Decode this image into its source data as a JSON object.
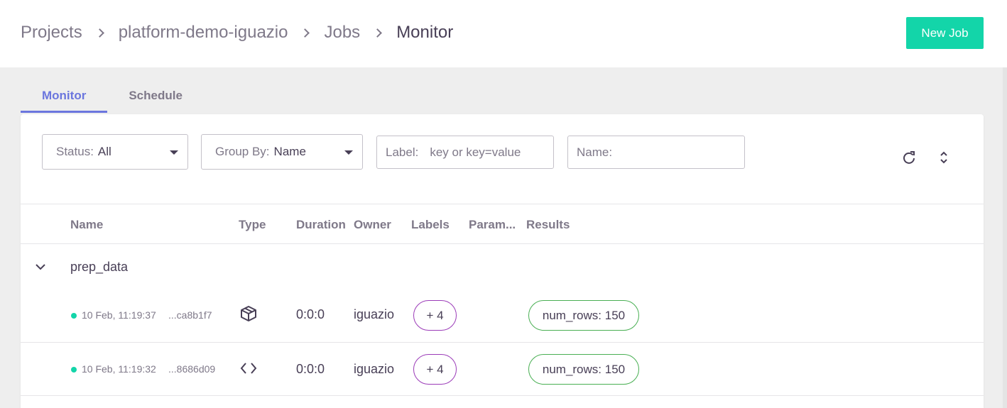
{
  "breadcrumb": {
    "items": [
      "Projects",
      "platform-demo-iguazio",
      "Jobs",
      "Monitor"
    ]
  },
  "header": {
    "new_job_label": "New Job"
  },
  "tabs": [
    {
      "label": "Monitor",
      "active": true
    },
    {
      "label": "Schedule",
      "active": false
    }
  ],
  "filters": {
    "status": {
      "label": "Status:",
      "value": "All"
    },
    "group_by": {
      "label": "Group By:",
      "value": "Name"
    },
    "labels": {
      "label": "Label:",
      "placeholder": "key or key=value",
      "value": ""
    },
    "name": {
      "label": "Name:",
      "placeholder": "",
      "value": ""
    }
  },
  "table": {
    "columns": [
      "Name",
      "Type",
      "Duration",
      "Owner",
      "Labels",
      "Param...",
      "Results"
    ],
    "groups": [
      {
        "name": "prep_data",
        "rows": [
          {
            "date": "10 Feb, 11:19:37",
            "uid": "...ca8b1f7",
            "type_icon": "package-icon",
            "duration": "0:0:0",
            "owner": "iguazio",
            "labels": "+ 4",
            "results": "num_rows: 150",
            "status_color": "#13d5a9"
          },
          {
            "date": "10 Feb, 11:19:32",
            "uid": "...8686d09",
            "type_icon": "code-icon",
            "duration": "0:0:0",
            "owner": "iguazio",
            "labels": "+ 4",
            "results": "num_rows: 150",
            "status_color": "#13d5a9"
          }
        ]
      }
    ]
  },
  "colors": {
    "accent": "#13d5a9",
    "tab_active": "#6b76de",
    "label_chip_border": "#9b3bb8",
    "result_chip_border": "#49af53"
  }
}
